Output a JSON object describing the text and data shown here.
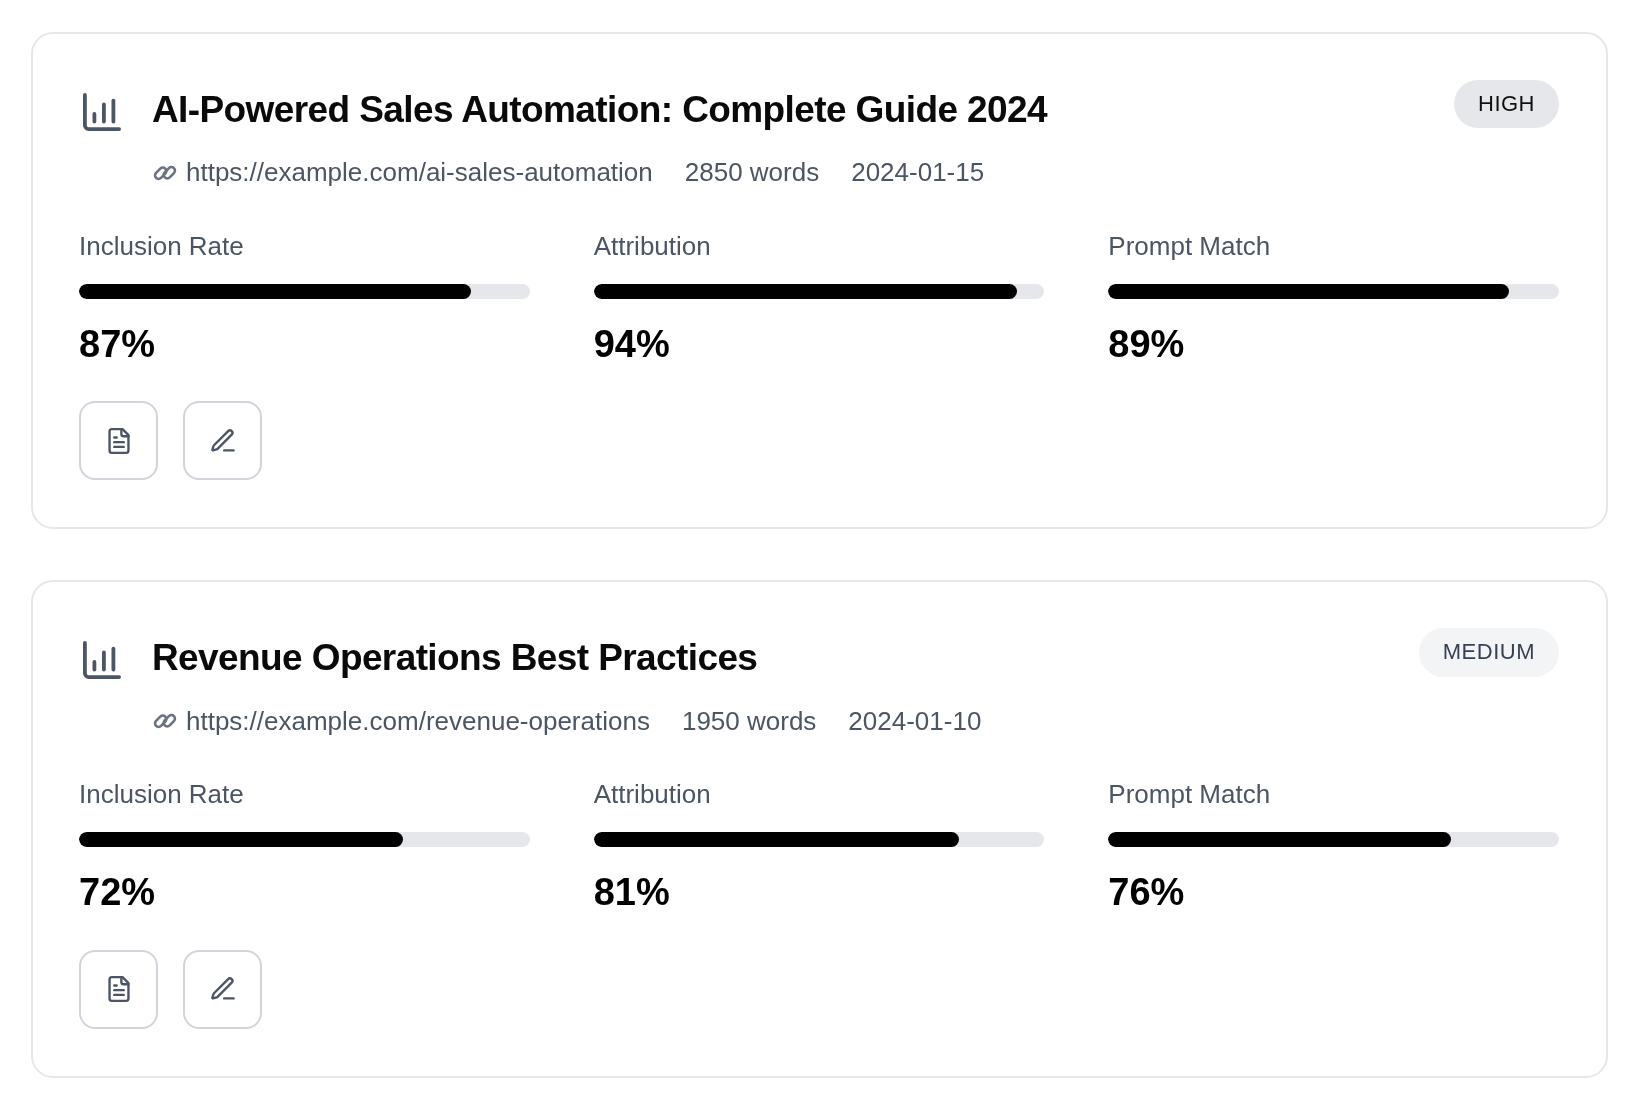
{
  "cards": [
    {
      "title": "AI-Powered Sales Automation: Complete Guide 2024",
      "priority": {
        "label": "HIGH",
        "kind": "high"
      },
      "url": "https://example.com/ai-sales-automation",
      "word_count": "2850 words",
      "date": "2024-01-15",
      "metrics": [
        {
          "label": "Inclusion Rate",
          "level": 0.87,
          "value": "87%"
        },
        {
          "label": "Attribution",
          "level": 0.94,
          "value": "94%"
        },
        {
          "label": "Prompt Match",
          "level": 0.89,
          "value": "89%"
        }
      ]
    },
    {
      "title": "Revenue Operations Best Practices",
      "priority": {
        "label": "MEDIUM",
        "kind": "medium"
      },
      "url": "https://example.com/revenue-operations",
      "word_count": "1950 words",
      "date": "2024-01-10",
      "metrics": [
        {
          "label": "Inclusion Rate",
          "level": 0.72,
          "value": "72%"
        },
        {
          "label": "Attribution",
          "level": 0.81,
          "value": "81%"
        },
        {
          "label": "Prompt Match",
          "level": 0.76,
          "value": "76%"
        }
      ]
    }
  ]
}
